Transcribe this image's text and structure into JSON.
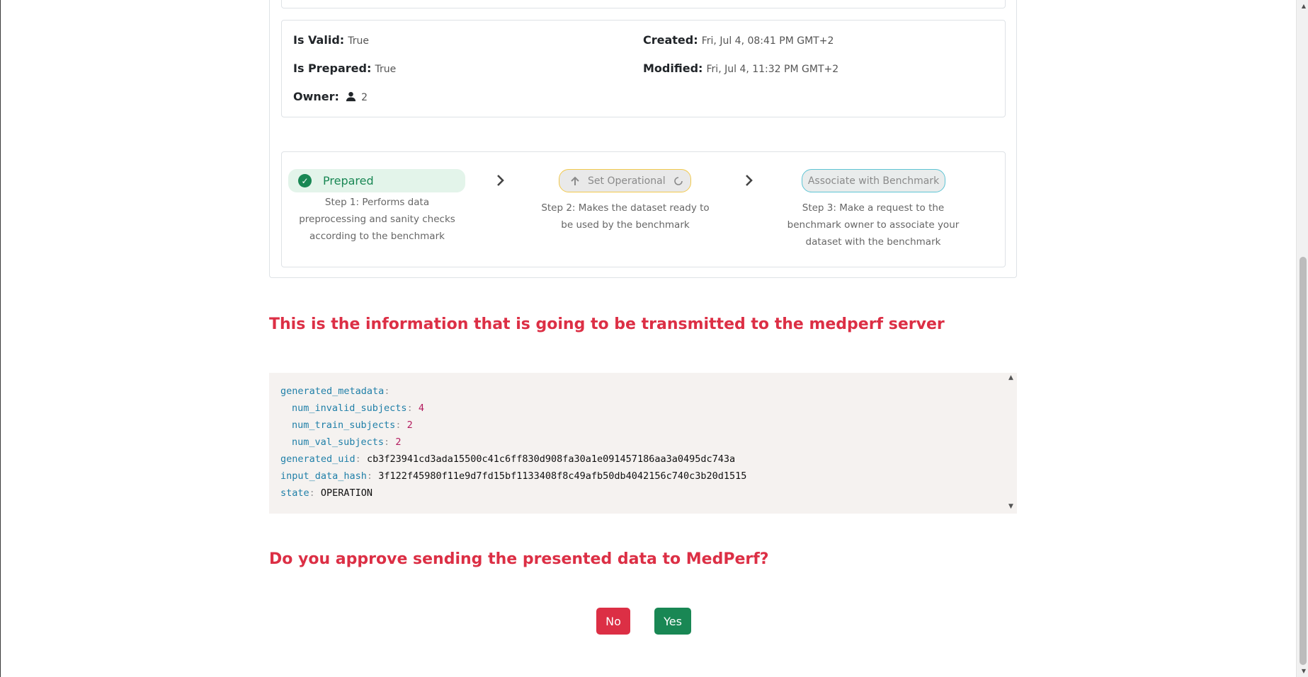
{
  "info": {
    "is_valid_label": "Is Valid:",
    "is_valid_value": "True",
    "is_prepared_label": "Is Prepared:",
    "is_prepared_value": "True",
    "owner_label": "Owner:",
    "owner_value": "2",
    "created_label": "Created:",
    "created_value": "Fri, Jul 4, 08:41 PM GMT+2",
    "modified_label": "Modified:",
    "modified_value": "Fri, Jul 4, 11:32 PM GMT+2"
  },
  "steps": [
    {
      "label": "Prepared",
      "status": "done",
      "description": "Step 1: Performs data preprocessing and sanity checks according to the benchmark"
    },
    {
      "label": "Set Operational",
      "status": "in-progress",
      "description": "Step 2: Makes the dataset ready to be used by the benchmark"
    },
    {
      "label": "Associate with Benchmark",
      "status": "pending",
      "description": "Step 3: Make a request to the benchmark owner to associate your dataset with the benchmark"
    }
  ],
  "transmit_heading": "This is the information that is going to be transmitted to the medperf server",
  "yaml": {
    "generated_metadata_key": "generated_metadata",
    "num_invalid_subjects_key": "num_invalid_subjects",
    "num_invalid_subjects": "4",
    "num_train_subjects_key": "num_train_subjects",
    "num_train_subjects": "2",
    "num_val_subjects_key": "num_val_subjects",
    "num_val_subjects": "2",
    "generated_uid_key": "generated_uid",
    "generated_uid": "cb3f23941cd3ada15500c41c6ff830d908fa30a1e091457186aa3a0495dc743a",
    "input_data_hash_key": "input_data_hash",
    "input_data_hash": "3f122f45980f11e9d7fd15bf1133408f8c49afb50db4042156c740c3b20d1515",
    "state_key": "state",
    "state": "OPERATION"
  },
  "approve_heading": "Do you approve sending the presented data to MedPerf?",
  "buttons": {
    "no": "No",
    "yes": "Yes"
  },
  "colors": {
    "danger": "#dc2f45",
    "success": "#198754",
    "warning_border": "#f2c94c",
    "info_border": "#5ec4d4"
  }
}
